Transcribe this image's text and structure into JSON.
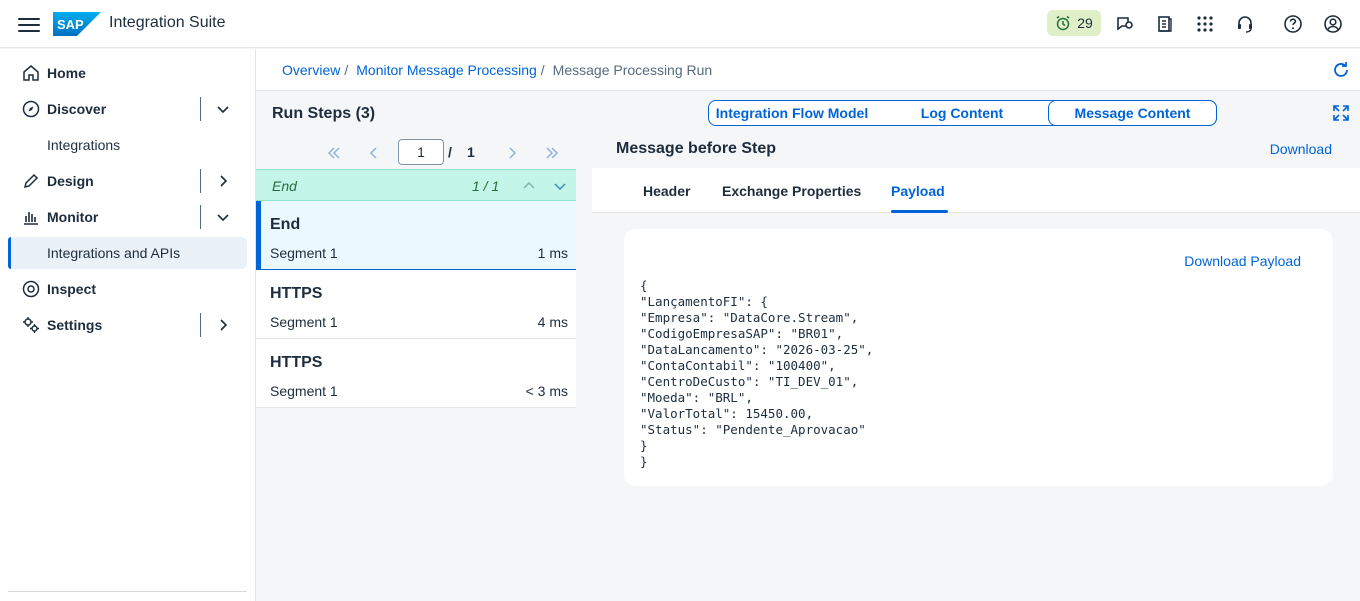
{
  "shell": {
    "product_name": "Integration Suite",
    "notification_count": "29",
    "brand_color": "#0a6ed1"
  },
  "sidenav": {
    "items": [
      {
        "label": "Home"
      },
      {
        "label": "Discover"
      },
      {
        "label": "Integrations"
      },
      {
        "label": "Design"
      },
      {
        "label": "Monitor"
      },
      {
        "label": "Integrations and APIs"
      },
      {
        "label": "Inspect"
      },
      {
        "label": "Settings"
      }
    ]
  },
  "breadcrumb": {
    "items": [
      "Overview",
      "Monitor Message Processing"
    ],
    "separator": "/",
    "current": "Message Processing Run"
  },
  "run_steps": {
    "title": "Run Steps (3)",
    "page_value": "1",
    "page_sep": "/",
    "page_total": "1",
    "filter_label": "End",
    "filter_count": "1 / 1",
    "steps": [
      {
        "name": "End",
        "segment": "Segment 1",
        "duration": "1 ms"
      },
      {
        "name": "HTTPS",
        "segment": "Segment 1",
        "duration": "4 ms"
      },
      {
        "name": "HTTPS",
        "segment": "Segment 1",
        "duration": "< 3 ms"
      }
    ]
  },
  "view_tabs": [
    "Integration Flow Model",
    "Log Content",
    "Message Content"
  ],
  "message": {
    "title": "Message before Step",
    "download_label": "Download",
    "tabs": [
      "Header",
      "Exchange Properties",
      "Payload"
    ],
    "download_payload_label": "Download Payload",
    "payload": "{\n\"LançamentoFI\": {\n\"Empresa\": \"DataCore.Stream\",\n\"CodigoEmpresaSAP\": \"BR01\",\n\"DataLancamento\": \"2026-03-25\",\n\"ContaContabil\": \"100400\",\n\"CentroDeCusto\": \"TI_DEV_01\",\n\"Moeda\": \"BRL\",\n\"ValorTotal\": 15450.00,\n\"Status\": \"Pendente_Aprovacao\"\n}\n}"
  }
}
